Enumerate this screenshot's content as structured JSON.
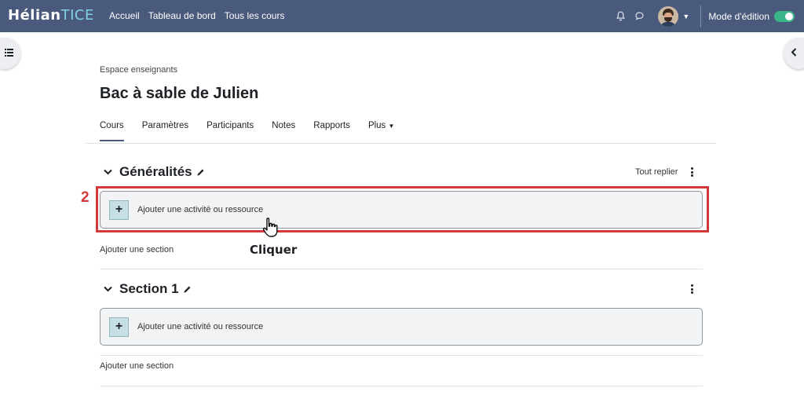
{
  "navbar": {
    "brand_part1": "Hélian",
    "brand_part2": "TICE",
    "links": [
      "Accueil",
      "Tableau de bord",
      "Tous les cours"
    ],
    "edit_mode_label": "Mode d'édition",
    "edit_mode_on": true
  },
  "breadcrumb": "Espace enseignants",
  "course_title": "Bac à sable de Julien",
  "tabs": {
    "items": [
      "Cours",
      "Paramètres",
      "Participants",
      "Notes",
      "Rapports"
    ],
    "more": "Plus",
    "active": "Cours"
  },
  "collapse_all": "Tout replier",
  "sections": [
    {
      "name": "Généralités",
      "add_activity": "Ajouter une activité ou ressource",
      "add_section": "Ajouter une section"
    },
    {
      "name": "Section 1",
      "add_activity": "Ajouter une activité ou ressource",
      "add_section": "Ajouter une section"
    }
  ],
  "annotation": {
    "step_number": "2",
    "click_label": "Cliquer"
  },
  "colors": {
    "navbar": "#4a5a7c",
    "toggle_on": "#3bb58a",
    "highlight": "#d13a3a",
    "brand_accent": "#7fd1e6"
  }
}
